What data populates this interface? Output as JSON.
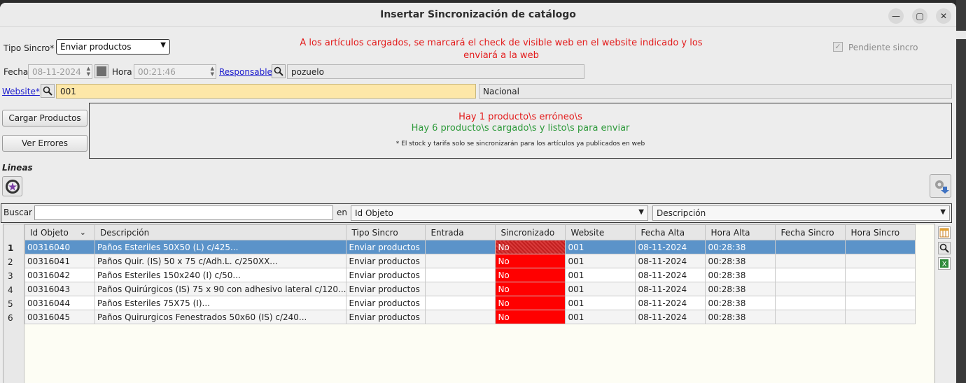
{
  "window": {
    "title": "Insertar Sincronización de catálogo"
  },
  "header": {
    "tipo_sincro_label": "Tipo Sincro*",
    "tipo_sincro_value": "Enviar productos",
    "info_line1": "A los artículos cargados, se marcará el check de visible web en el website indicado y los",
    "info_line2": "enviará a la web",
    "pendiente_label": "Pendiente sincro",
    "fecha_label": "Fecha",
    "fecha_value": "08-11-2024",
    "hora_label": "Hora",
    "hora_value": "00:21:46",
    "responsable_label": "Responsable",
    "responsable_value": "pozuelo",
    "website_label": "Website*",
    "website_code": "001",
    "website_name": "Nacional"
  },
  "actions": {
    "cargar": "Cargar Productos",
    "ver_errores": "Ver Errores"
  },
  "messages": {
    "errors": "Hay 1 producto\\s erróneo\\s",
    "loaded": "Hay 6 producto\\s cargado\\s y listo\\s para enviar",
    "note": "* El stock y tarifa solo se sincronizarán para los artículos ya publicados en web"
  },
  "lines": {
    "title": "Lineas",
    "buscar_label": "Buscar",
    "buscar_value": "",
    "en_label": "en",
    "campo_value": "Id Objeto",
    "orden_value": "Descripción"
  },
  "table": {
    "columns": [
      "Id Objeto",
      "Descripción",
      "Tipo Sincro",
      "Entrada",
      "Sincronizado",
      "Website",
      "Fecha Alta",
      "Hora Alta",
      "Fecha Sincro",
      "Hora Sincro"
    ],
    "rows": [
      {
        "n": "1",
        "id": "00316040",
        "desc": "Paños Esteriles 50X50 (L) c/425...",
        "tipo": "Enviar productos",
        "entrada": "",
        "sinc": "No",
        "web": "001",
        "fecha": "08-11-2024",
        "hora": "00:28:38",
        "fs": "",
        "hs": ""
      },
      {
        "n": "2",
        "id": "00316041",
        "desc": "Paños Quir. (IS) 50 x 75 c/Adh.L. c/250XX...",
        "tipo": "Enviar productos",
        "entrada": "",
        "sinc": "No",
        "web": "001",
        "fecha": "08-11-2024",
        "hora": "00:28:38",
        "fs": "",
        "hs": ""
      },
      {
        "n": "3",
        "id": "00316042",
        "desc": "Paños Esteriles 150x240 (I) c/50...",
        "tipo": "Enviar productos",
        "entrada": "",
        "sinc": "No",
        "web": "001",
        "fecha": "08-11-2024",
        "hora": "00:28:38",
        "fs": "",
        "hs": ""
      },
      {
        "n": "4",
        "id": "00316043",
        "desc": "Paños Quirúrgicos (IS) 75 x 90 con adhesivo lateral c/120...",
        "tipo": "Enviar productos",
        "entrada": "",
        "sinc": "No",
        "web": "001",
        "fecha": "08-11-2024",
        "hora": "00:28:38",
        "fs": "",
        "hs": ""
      },
      {
        "n": "5",
        "id": "00316044",
        "desc": "Paños Esteriles 75X75 (I)...",
        "tipo": "Enviar productos",
        "entrada": "",
        "sinc": "No",
        "web": "001",
        "fecha": "08-11-2024",
        "hora": "00:28:38",
        "fs": "",
        "hs": ""
      },
      {
        "n": "6",
        "id": "00316045",
        "desc": "Paños Quirurgicos Fenestrados 50x60 (IS) c/240...",
        "tipo": "Enviar productos",
        "entrada": "",
        "sinc": "No",
        "web": "001",
        "fecha": "08-11-2024",
        "hora": "00:28:38",
        "fs": "",
        "hs": ""
      }
    ]
  }
}
